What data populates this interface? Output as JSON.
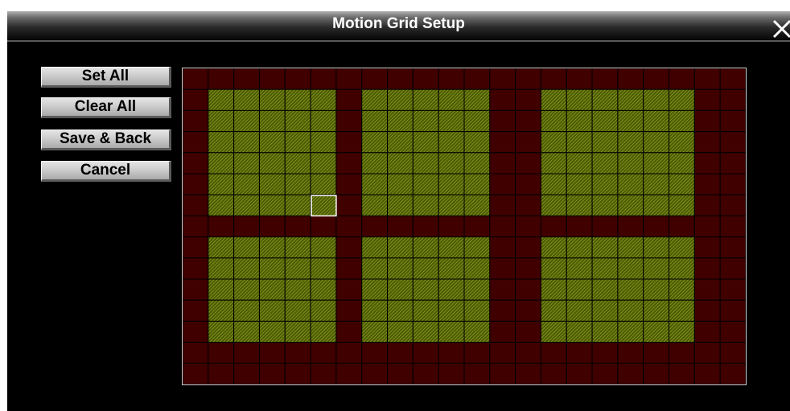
{
  "window": {
    "title": "Motion Grid Setup"
  },
  "buttons": {
    "set_all": "Set All",
    "clear_all": "Clear All",
    "save_back": "Save & Back",
    "cancel": "Cancel"
  },
  "grid": {
    "columns": 22,
    "rows": 15,
    "cursor": {
      "row": 6,
      "col": 5
    },
    "active_regions": [
      {
        "row_start": 1,
        "row_end": 6,
        "col_start": 1,
        "col_end": 5
      },
      {
        "row_start": 1,
        "row_end": 6,
        "col_start": 7,
        "col_end": 11
      },
      {
        "row_start": 1,
        "row_end": 6,
        "col_start": 14,
        "col_end": 19
      },
      {
        "row_start": 8,
        "row_end": 12,
        "col_start": 1,
        "col_end": 5
      },
      {
        "row_start": 8,
        "row_end": 12,
        "col_start": 7,
        "col_end": 11
      },
      {
        "row_start": 8,
        "row_end": 12,
        "col_start": 14,
        "col_end": 19
      }
    ]
  },
  "colors": {
    "inactive_cell": "#400000",
    "active_cell": "#4a5a00",
    "active_hatch": "#9aa82a",
    "grid_line": "#000000",
    "cursor": "#ffffff"
  },
  "icons": {
    "close": "close-icon"
  }
}
